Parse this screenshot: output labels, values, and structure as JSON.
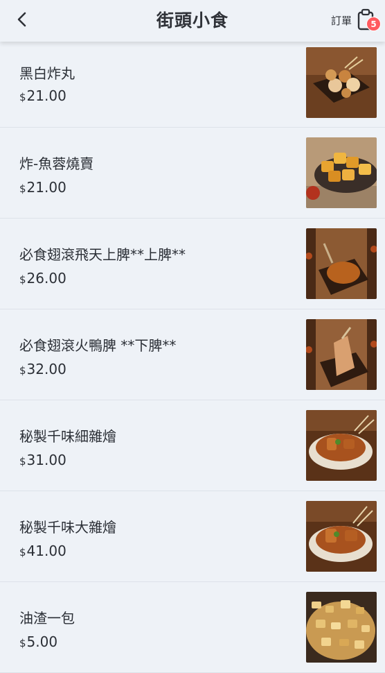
{
  "header": {
    "title": "街頭小食",
    "order_label": "訂單",
    "cart_count": "5"
  },
  "items": [
    {
      "name": "黑白炸丸",
      "currency": "$",
      "price": "21.00",
      "image": "fried-fishballs-photo"
    },
    {
      "name": "炸-魚蓉燒賣",
      "currency": "$",
      "price": "21.00",
      "image": "fried-siumai-photo"
    },
    {
      "name": "必食翅滾飛天上脾**上脾**",
      "currency": "$",
      "price": "26.00",
      "image": "goose-upper-leg-photo"
    },
    {
      "name": "必食翅滾火鴨脾 **下脾**",
      "currency": "$",
      "price": "32.00",
      "image": "roast-duck-leg-photo"
    },
    {
      "name": "秘製千味細雜燴",
      "currency": "$",
      "price": "31.00",
      "image": "small-mixed-stew-photo"
    },
    {
      "name": "秘製千味大雜燴",
      "currency": "$",
      "price": "41.00",
      "image": "large-mixed-stew-photo"
    },
    {
      "name": "油渣一包",
      "currency": "$",
      "price": "5.00",
      "image": "pork-crackling-photo"
    }
  ],
  "colors": {
    "background": "#eef2f7",
    "badge": "#ff5a5f",
    "text": "#2b2f36"
  }
}
